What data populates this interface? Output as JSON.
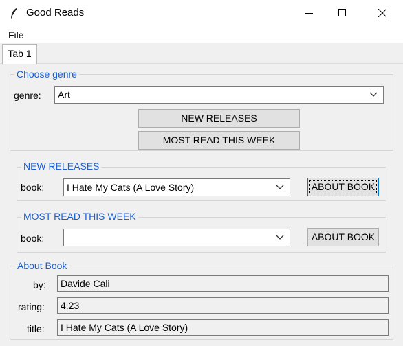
{
  "window": {
    "title": "Good Reads",
    "icon": "feather-icon"
  },
  "menu": {
    "file": "File"
  },
  "tabs": [
    {
      "label": "Tab 1"
    }
  ],
  "choose_genre": {
    "title": "Choose genre",
    "genre_label": "genre:",
    "genre_value": "Art",
    "new_releases_button": "NEW RELEASES",
    "most_read_button": "MOST READ THIS WEEK"
  },
  "new_releases": {
    "title": "NEW RELEASES",
    "book_label": "book:",
    "book_value": "I Hate My Cats (A Love Story)",
    "about_button": "ABOUT BOOK"
  },
  "most_read": {
    "title": "MOST READ THIS WEEK",
    "book_label": "book:",
    "book_value": "",
    "about_button": "ABOUT BOOK"
  },
  "about_book": {
    "title": "About Book",
    "by_label": "by:",
    "by_value": "Davide Cali",
    "rating_label": "rating:",
    "rating_value": "4.23",
    "title_label": "title:",
    "title_value": "I Hate My Cats (A Love Story)"
  },
  "colors": {
    "accent": "#1a5fd6",
    "background": "#f0f0f0"
  }
}
